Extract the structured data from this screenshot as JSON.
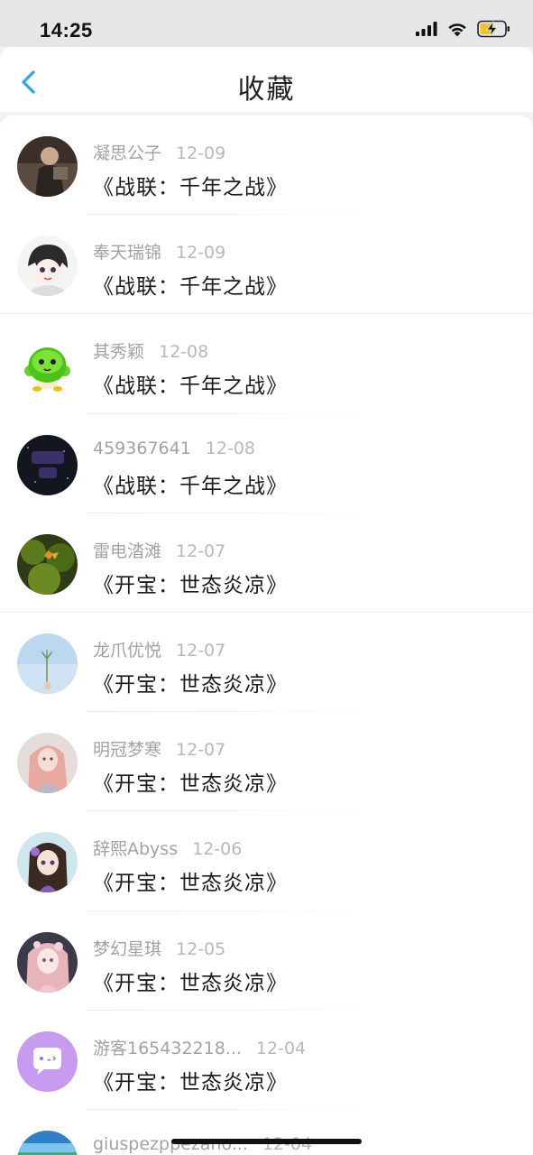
{
  "status_bar": {
    "time": "14:25"
  },
  "header": {
    "title": "收藏"
  },
  "items": [
    {
      "user": "凝思公子",
      "date": "12-09",
      "work": "《战联：千年之战》"
    },
    {
      "user": "奉天瑞锦",
      "date": "12-09",
      "work": "《战联：千年之战》"
    },
    {
      "user": "其秀颖",
      "date": "12-08",
      "work": "《战联：千年之战》"
    },
    {
      "user": "459367641",
      "date": "12-08",
      "work": "《战联：千年之战》"
    },
    {
      "user": "雷电涾滩",
      "date": "12-07",
      "work": "《开宝：世态炎凉》"
    },
    {
      "user": "龙爪优悦",
      "date": "12-07",
      "work": "《开宝：世态炎凉》"
    },
    {
      "user": "明冠梦寒",
      "date": "12-07",
      "work": "《开宝：世态炎凉》"
    },
    {
      "user": "辞熙Abyss",
      "date": "12-06",
      "work": "《开宝：世态炎凉》"
    },
    {
      "user": "梦幻星琪",
      "date": "12-05",
      "work": "《开宝：世态炎凉》"
    },
    {
      "user": "游客165432218...",
      "date": "12-04",
      "work": "《开宝：世态炎凉》"
    },
    {
      "user": "giuspezppezano...",
      "date": "12-04",
      "work": ""
    }
  ],
  "colors": {
    "accent": "#2aa7e0",
    "title": "#222222",
    "meta": "#a2a2a6"
  }
}
